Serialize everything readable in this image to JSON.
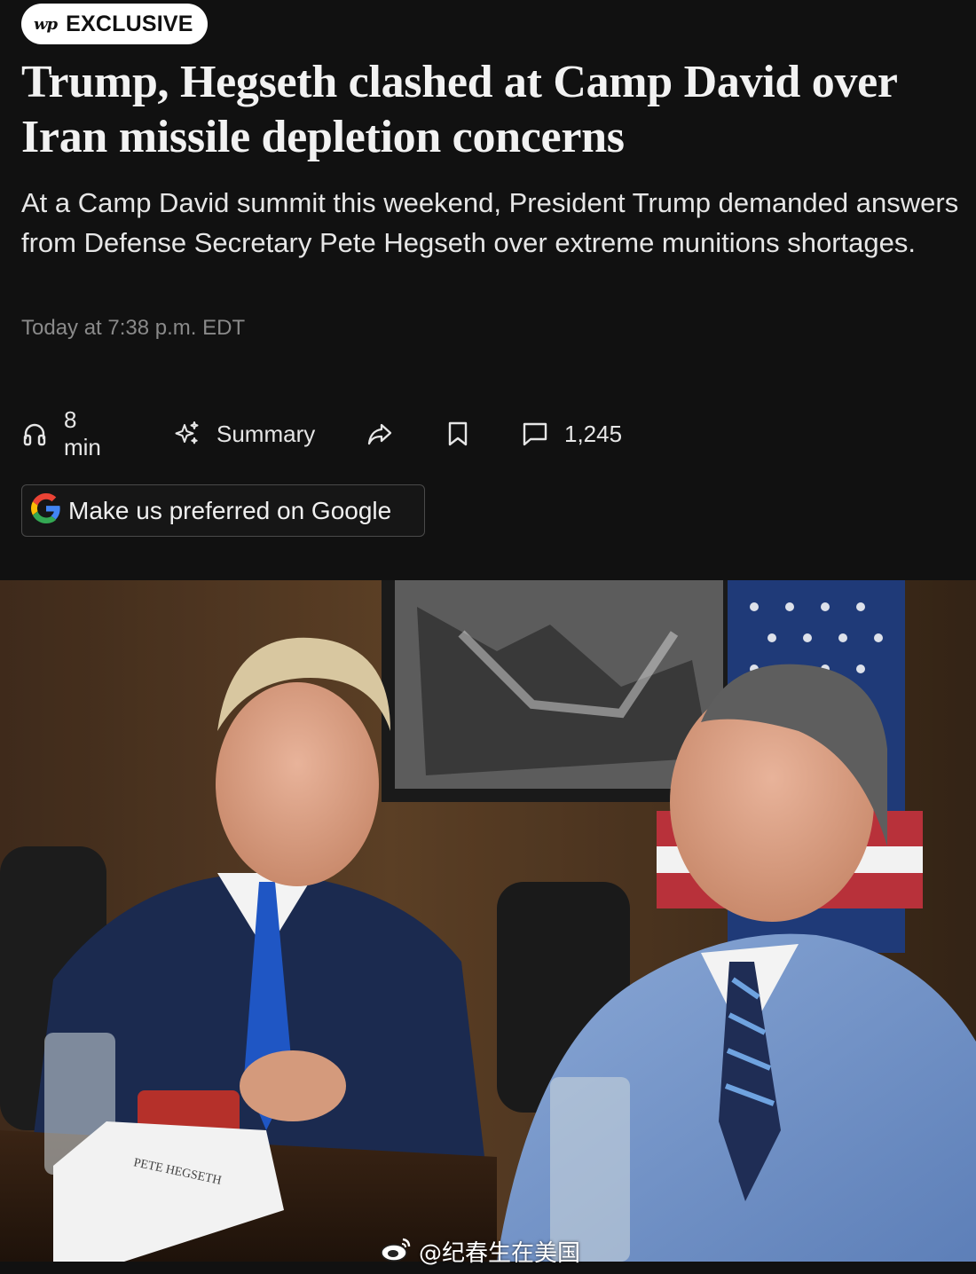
{
  "label": {
    "logo": "wp",
    "text": "EXCLUSIVE"
  },
  "headline": "Trump, Hegseth clashed at Camp David over Iran missile depletion concerns",
  "dek": "At a Camp David summit this weekend, President Trump demanded answers from Defense Secretary Pete Hegseth over extreme munitions shortages.",
  "timestamp": "Today at 7:38 p.m. EDT",
  "toolbar": {
    "listen_label": "8 min",
    "summary_label": "Summary",
    "comments_count": "1,245",
    "icons": [
      "headphones-icon",
      "sparkle-icon",
      "share-icon",
      "bookmark-icon",
      "comment-icon"
    ]
  },
  "google_button": {
    "label": "Make us preferred on Google",
    "icon": "google-g-icon"
  },
  "photo": {
    "nameplate_text": "PETE HEGSETH"
  },
  "watermark": {
    "text": "@纪春生在美国",
    "icon": "weibo-icon"
  },
  "colors": {
    "background": "#111111",
    "text_primary": "#f2f2f2",
    "text_muted": "#8a8a8a",
    "pill_bg": "#ffffff"
  }
}
